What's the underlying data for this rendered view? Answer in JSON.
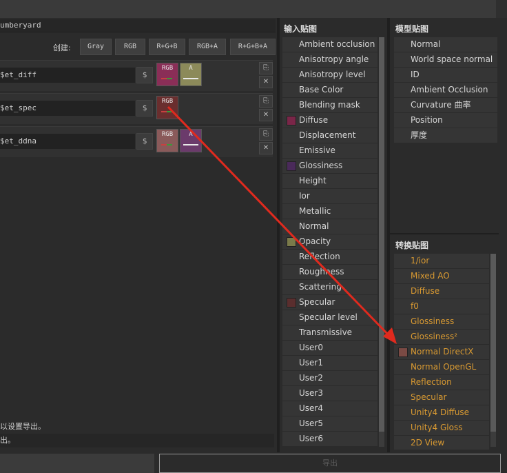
{
  "preset_name": "umberyard",
  "create_label": "创建:",
  "channel_buttons": [
    "Gray",
    "RGB",
    "R+G+B",
    "RGB+A",
    "R+G+B+A"
  ],
  "output_maps": [
    {
      "name": "$et_diff",
      "dollar": "$",
      "chips": [
        {
          "label": "RGB",
          "color": "#8a2e57",
          "bar": "#3a9a3a"
        },
        {
          "label": "A",
          "color": "#8c8a5a",
          "bar": "#e8e8e8"
        }
      ]
    },
    {
      "name": "$et_spec",
      "dollar": "$",
      "chips": [
        {
          "label": "RGB",
          "color": "#6a2e2e",
          "bar": "#3a9a3a"
        }
      ]
    },
    {
      "name": "$et_ddna",
      "dollar": "$",
      "chips": [
        {
          "label": "RGB",
          "color": "#8a5a5a",
          "bar": "#3a9a3a"
        },
        {
          "label": "A",
          "color": "#6b3a6b",
          "bar": "#e8e8e8"
        }
      ]
    }
  ],
  "status_line1": "以设置导出。",
  "status_line2": "出。",
  "export_label": "导出",
  "input_maps": {
    "title": "输入贴图",
    "items": [
      {
        "label": "Ambient occlusion",
        "swatch": null
      },
      {
        "label": "Anisotropy angle",
        "swatch": null
      },
      {
        "label": "Anisotropy level",
        "swatch": null
      },
      {
        "label": "Base Color",
        "swatch": null
      },
      {
        "label": "Blending mask",
        "swatch": null
      },
      {
        "label": "Diffuse",
        "swatch": "#7a2648"
      },
      {
        "label": "Displacement",
        "swatch": null
      },
      {
        "label": "Emissive",
        "swatch": null
      },
      {
        "label": "Glossiness",
        "swatch": "#4a2a5a"
      },
      {
        "label": "Height",
        "swatch": null
      },
      {
        "label": "Ior",
        "swatch": null
      },
      {
        "label": "Metallic",
        "swatch": null
      },
      {
        "label": "Normal",
        "swatch": null
      },
      {
        "label": "Opacity",
        "swatch": "#7a7a4a"
      },
      {
        "label": "Reflection",
        "swatch": null
      },
      {
        "label": "Roughness",
        "swatch": null
      },
      {
        "label": "Scattering",
        "swatch": null
      },
      {
        "label": "Specular",
        "swatch": "#5a2e2e"
      },
      {
        "label": "Specular level",
        "swatch": null
      },
      {
        "label": "Transmissive",
        "swatch": null
      },
      {
        "label": "User0",
        "swatch": null
      },
      {
        "label": "User1",
        "swatch": null
      },
      {
        "label": "User2",
        "swatch": null
      },
      {
        "label": "User3",
        "swatch": null
      },
      {
        "label": "User4",
        "swatch": null
      },
      {
        "label": "User5",
        "swatch": null
      },
      {
        "label": "User6",
        "swatch": null
      }
    ]
  },
  "model_maps": {
    "title": "模型贴图",
    "items": [
      "Normal",
      "World space normal",
      "ID",
      "Ambient Occlusion",
      "Curvature 曲率",
      "Position",
      "厚度"
    ]
  },
  "converted_maps": {
    "title": "转换贴图",
    "items": [
      {
        "label": "1/ior",
        "swatch": null
      },
      {
        "label": "Mixed AO",
        "swatch": null
      },
      {
        "label": "Diffuse",
        "swatch": null
      },
      {
        "label": "f0",
        "swatch": null
      },
      {
        "label": "Glossiness",
        "swatch": null
      },
      {
        "label": "Glossiness²",
        "swatch": null
      },
      {
        "label": "Normal DirectX",
        "swatch": "#7a4a44"
      },
      {
        "label": "Normal OpenGL",
        "swatch": null
      },
      {
        "label": "Reflection",
        "swatch": null
      },
      {
        "label": "Specular",
        "swatch": null
      },
      {
        "label": "Unity4 Diffuse",
        "swatch": null
      },
      {
        "label": "Unity4 Gloss",
        "swatch": null
      },
      {
        "label": "2D View",
        "swatch": null
      }
    ]
  },
  "colors": {
    "accent_orange": "#d99a32",
    "annotation_arrow": "#e02a1e"
  }
}
